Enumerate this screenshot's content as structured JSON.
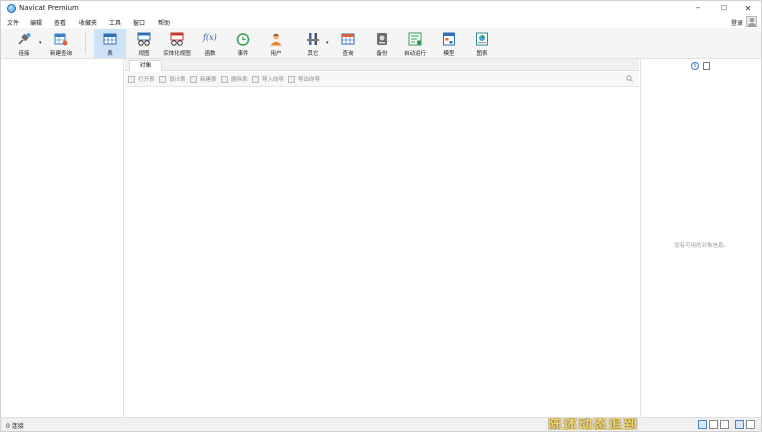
{
  "window": {
    "title": "Navicat Premium",
    "controls": [
      "–",
      "☐",
      "✕"
    ]
  },
  "menu": [
    "文件",
    "编辑",
    "查看",
    "收藏夹",
    "工具",
    "窗口",
    "帮助"
  ],
  "login_label": "登录",
  "toolbar": {
    "connect": "连接",
    "new_query": "新建查询",
    "table": "表",
    "view": "视图",
    "mat_view": "实体化视图",
    "function": "函数",
    "event": "事件",
    "user": "用户",
    "other": "其它",
    "query": "查询",
    "backup": "备份",
    "auto_run": "自动运行",
    "model": "模型",
    "chart": "图表",
    "function_glyph": "f(x)"
  },
  "tabs": {
    "objects": "对象"
  },
  "object_toolbar": [
    "打开表",
    "设计表",
    "新建表",
    "删除表",
    "导入向导",
    "导出向导"
  ],
  "right_pane": {
    "no_info": "没有可用的对象信息。",
    "info_glyph": "i"
  },
  "status": {
    "connections": "0 连接"
  },
  "overlay_caption": "陈述动态追到"
}
